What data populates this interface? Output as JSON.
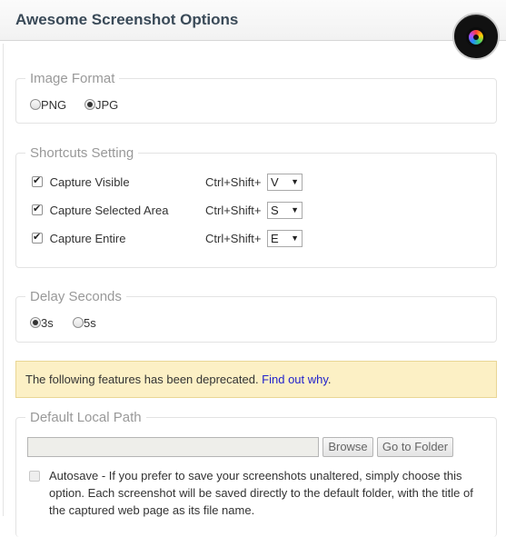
{
  "header": {
    "title": "Awesome Screenshot Options",
    "logo_icon": "camera-lens-icon"
  },
  "image_format": {
    "legend": "Image Format",
    "options": [
      {
        "label": "PNG",
        "selected": false
      },
      {
        "label": "JPG",
        "selected": true
      }
    ]
  },
  "shortcuts": {
    "legend": "Shortcuts Setting",
    "items": [
      {
        "label": "Capture Visible",
        "checked": true,
        "modifier": "Ctrl+Shift+",
        "key": "V"
      },
      {
        "label": "Capture Selected Area",
        "checked": true,
        "modifier": "Ctrl+Shift+",
        "key": "S"
      },
      {
        "label": "Capture Entire",
        "checked": true,
        "modifier": "Ctrl+Shift+",
        "key": "E"
      }
    ]
  },
  "delay": {
    "legend": "Delay Seconds",
    "options": [
      {
        "label": "3s",
        "selected": true
      },
      {
        "label": "5s",
        "selected": false
      }
    ]
  },
  "notice": {
    "text": "The following features has been deprecated. ",
    "link": "Find out why",
    "suffix": "."
  },
  "local_path": {
    "legend": "Default Local Path",
    "value": "",
    "browse_label": "Browse",
    "folder_label": "Go to Folder",
    "autosave_checked": false,
    "autosave_text": "Autosave - If you prefer to save your screenshots unaltered, simply choose this option. Each screenshot will be saved directly to the default folder, with the title of the captured web page as its file name."
  },
  "colors": {
    "notice_bg": "#fcf0c5",
    "link": "#2222cc",
    "title": "#3a4a58"
  }
}
